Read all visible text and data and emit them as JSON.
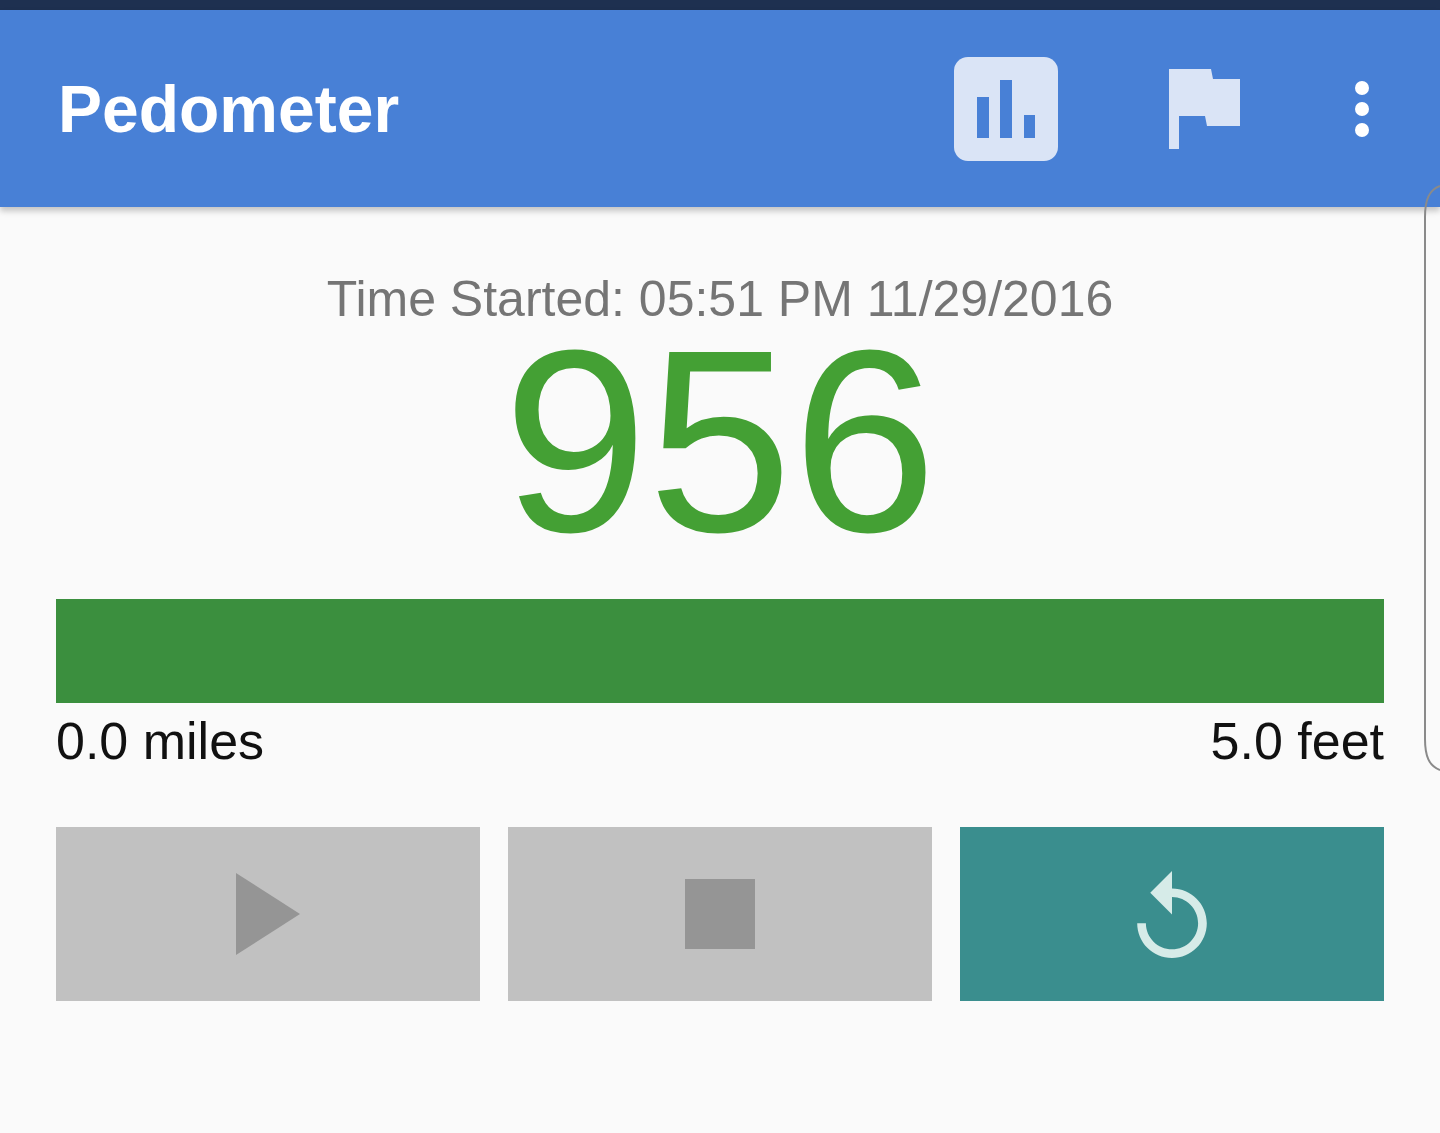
{
  "app_bar": {
    "title": "Pedometer",
    "actions": [
      {
        "kind": "chart",
        "selected": true
      },
      {
        "kind": "flag",
        "selected": false
      },
      {
        "kind": "menu",
        "selected": false
      }
    ]
  },
  "session": {
    "time_started": "Time Started: 05:51 PM 11/29/2016",
    "steps": "956"
  },
  "progress": {
    "level": 1,
    "start_label": "0.0 miles",
    "end_label": "5.0 feet"
  },
  "controls": [
    {
      "kind": "play",
      "disabled": true
    },
    {
      "kind": "stop",
      "disabled": true
    },
    {
      "kind": "reset",
      "disabled": false
    }
  ]
}
